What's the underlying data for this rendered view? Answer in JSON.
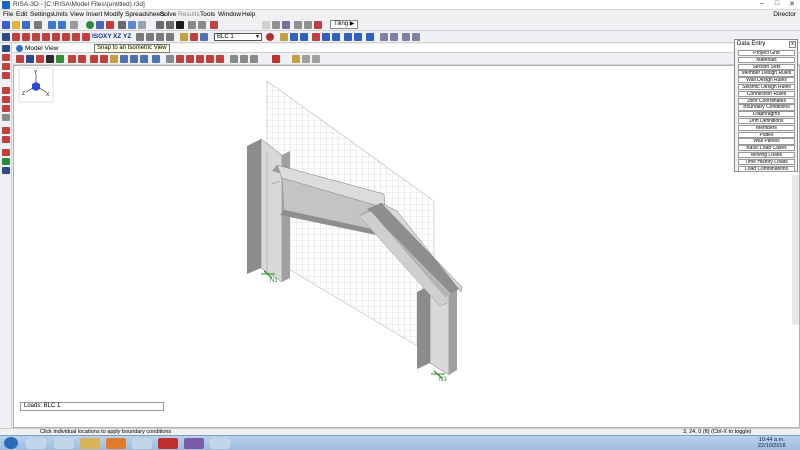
{
  "window": {
    "title": "RISA-3D - [C:\\RISA\\Model Files\\(untitled).r3d]",
    "minimize": "–",
    "maximize": "□",
    "close": "✕"
  },
  "menu": {
    "items": [
      "File",
      "Edit",
      "Settings",
      "Units",
      "View",
      "Insert",
      "Modify",
      "Spreadsheets",
      "Solve",
      "Results",
      "Tools",
      "Window",
      "Help"
    ],
    "user": "Director"
  },
  "toolbar1": {
    "tiling_label": "Tiling ▶"
  },
  "toolbar2": {
    "plane_labels": [
      "ISO",
      "XY",
      "XZ",
      "YZ"
    ],
    "load_case": "BLC 1",
    "lc_label": "LC"
  },
  "model_view": {
    "title": "Model View",
    "tooltip": "Snap to an Isometric View",
    "loads_label": "Loads: BLC 1",
    "node_labels": [
      "N1",
      "N3"
    ],
    "axes": [
      "Y",
      "Z",
      "X"
    ]
  },
  "data_entry": {
    "title": "Data Entry",
    "close": "x",
    "items": [
      "Project Grid",
      "Materials",
      "Section Sets",
      "Member Design Rules",
      "Wall Design Rules",
      "Seismic Design Rules",
      "Connection Rules",
      "Joint Coordinates",
      "Boundary Conditions",
      "Diaphragms",
      "Drift Definitions",
      "Members",
      "Plates",
      "Wall Panels",
      "Basic Load Cases",
      "Moving Loads",
      "Time History Loads",
      "Load Combinations"
    ]
  },
  "status": {
    "message": "Click individual locations to apply boundary conditions",
    "coords": "3, 24, 0 (ft)  (Ctrl-X to toggle)"
  },
  "taskbar": {
    "time": "10:44 a.m.",
    "date": "22/10/2018"
  },
  "colors": {
    "steel_light": "#d8d8d8",
    "steel_mid": "#b8b8b8",
    "steel_dark": "#8c8c8c",
    "grid": "#c8c8c8",
    "support": "#2e8b2e"
  }
}
